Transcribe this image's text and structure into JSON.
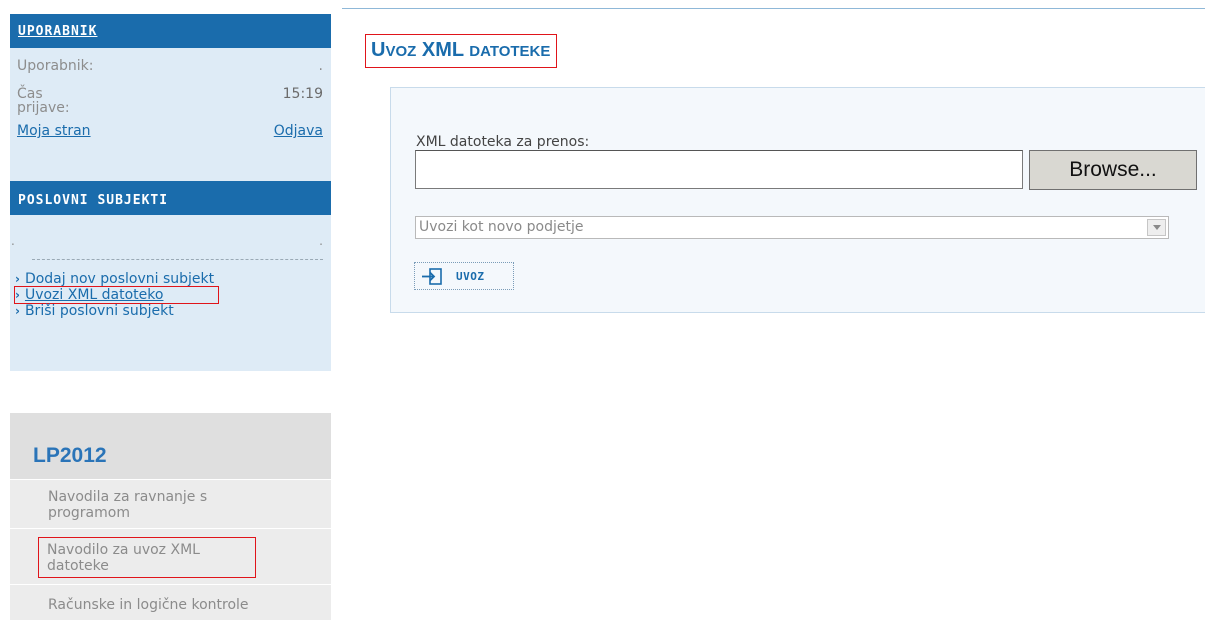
{
  "sidebar": {
    "user_box": {
      "header": "UPORABNIK",
      "user_label": "Uporabnik:",
      "user_value": ".",
      "login_time_label_1": "Čas",
      "login_time_label_2": "prijave:",
      "login_time_value": "15:19",
      "my_page_link": "Moja stran",
      "logout_link": "Odjava"
    },
    "subjects_box": {
      "header": "POSLOVNI SUBJEKTI",
      "dot_left": ".",
      "dot_right": ".",
      "items": [
        {
          "label": "Dodaj nov poslovni subjekt"
        },
        {
          "label": "Uvozi XML datoteko"
        },
        {
          "label": "Briši poslovni subjekt"
        }
      ]
    },
    "lp_box": {
      "title": "LP2012",
      "items": [
        {
          "label_line1": "Navodila za ravnanje s",
          "label_line2": "programom"
        },
        {
          "label_line1": "Navodilo za uvoz XML",
          "label_line2": "datoteke"
        },
        {
          "label_line1": "Računske in logične kontrole"
        }
      ]
    }
  },
  "main": {
    "title_part1": "U",
    "title_part2": "VOZ",
    "title_part3": " XML ",
    "title_part4": "DATOTEKE",
    "form": {
      "file_label": "XML datoteka za prenos:",
      "file_value": "",
      "browse_label": "Browse...",
      "select_value": "Uvozi kot novo podjetje",
      "import_button": "UVOZ"
    }
  },
  "colors": {
    "accent_blue": "#1a6cac",
    "highlight_red": "#e0141a",
    "sidebar_light": "#deebf6"
  }
}
